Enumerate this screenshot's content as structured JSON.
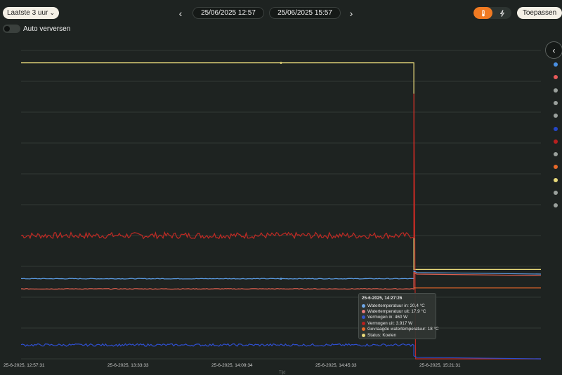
{
  "toolbar": {
    "range_label": "Laatste 3 uur",
    "date_from": "25/06/2025 12:57",
    "date_to": "25/06/2025 15:57",
    "apply_label": "Toepassen",
    "auto_refresh_label": "Auto verversen",
    "auto_refresh_on": false,
    "icons": {
      "prev": "chevron-left-icon",
      "next": "chevron-right-icon",
      "temperature": "thermometer-icon",
      "power": "lightning-icon",
      "collapse": "chevron-left-icon"
    }
  },
  "colors": {
    "accent": "#f07a22",
    "background": "#1e2321"
  },
  "legend": {
    "dots": [
      "#4a90e2",
      "#e85a5a",
      "#9aa09c",
      "#9aa09c",
      "#9aa09c",
      "#2446c7",
      "#b8201f",
      "#9aa09c",
      "#e8692a",
      "#e8d97a",
      "#9aa09c",
      "#9aa09c"
    ]
  },
  "tooltip": {
    "title": "25-6-2025, 14:27:26",
    "rows": [
      {
        "label": "Watertemperatuur in: 20,4 °C",
        "color": "#6fa8e8"
      },
      {
        "label": "Watertemperatuur uit: 17,9 °C",
        "color": "#e87a7a"
      },
      {
        "label": "Vermogen in: 460 W",
        "color": "#3656c9"
      },
      {
        "label": "Vermogen uit: 3.917 W",
        "color": "#b8201f"
      },
      {
        "label": "Gevraagde watertemperatuur: 18 °C",
        "color": "#e8692a"
      },
      {
        "label": "Status: Koelen",
        "color": "#e8d97a"
      }
    ]
  },
  "chart_data": {
    "type": "line",
    "xlabel": "Tijd",
    "x_ticks": [
      "25-6-2025, 12:57:31",
      "25-6-2025, 13:33:33",
      "25-6-2025, 14:09:34",
      "25-6-2025, 14:45:33",
      "25-6-2025, 15:21:31"
    ],
    "x_range_minutes": [
      0,
      180
    ],
    "y_range": [
      0,
      10
    ],
    "grid": true,
    "tooltip_time_minutes": 90,
    "drop_time_minutes": 136,
    "series": [
      {
        "name": "Status",
        "color": "#e8d97a",
        "points": [
          [
            0,
            9.6
          ],
          [
            136,
            9.6
          ],
          [
            136,
            2.9
          ],
          [
            180,
            2.9
          ]
        ]
      },
      {
        "name": "Vermogen uit",
        "color": "#c02a24",
        "base": 4.0,
        "noise": 0.1,
        "peak": 8.6,
        "end": 0.0
      },
      {
        "name": "Watertemperatuur in",
        "color": "#5b9ae0",
        "base": 2.6,
        "end": 2.75
      },
      {
        "name": "Watertemperatuur uit",
        "color": "#e0604f",
        "base": 2.27,
        "end": 2.7
      },
      {
        "name": "Gevraagde watertemperatuur",
        "color": "#e8692a",
        "points": [
          [
            136,
            2.3
          ],
          [
            180,
            2.3
          ]
        ]
      },
      {
        "name": "Vermogen in",
        "color": "#2f4fd1",
        "base": 0.45,
        "noise": 0.04,
        "end": 0.0
      }
    ]
  }
}
